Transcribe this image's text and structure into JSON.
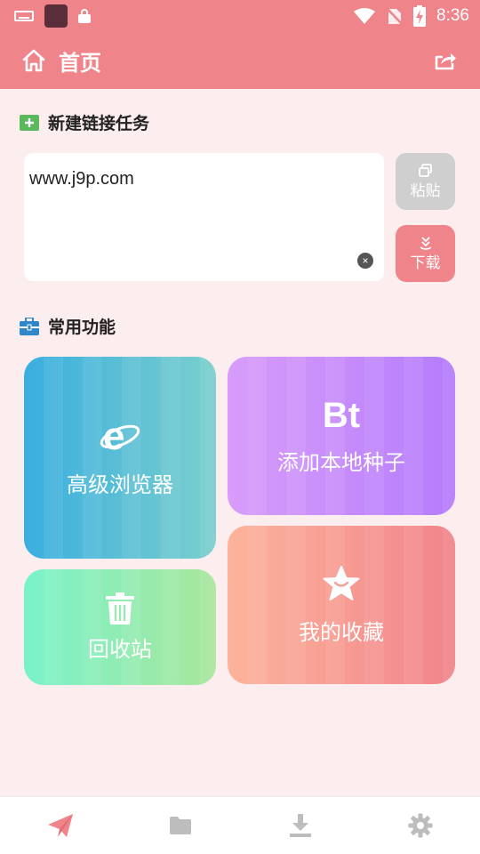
{
  "status_bar": {
    "time": "8:36"
  },
  "app_bar": {
    "title": "首页"
  },
  "new_task": {
    "heading": "新建链接任务",
    "url_value": "www.j9p.com",
    "paste_label": "粘贴",
    "download_label": "下载"
  },
  "features": {
    "heading": "常用功能",
    "browser_label": "高级浏览器",
    "bt_badge": "Bt",
    "bt_label": "添加本地种子",
    "trash_label": "回收站",
    "favorites_label": "我的收藏"
  },
  "bottom_nav": {
    "items": [
      {
        "icon": "send-icon",
        "active": true
      },
      {
        "icon": "folder-icon",
        "active": false
      },
      {
        "icon": "download-icon",
        "active": false
      },
      {
        "icon": "gear-icon",
        "active": false
      }
    ]
  },
  "colors": {
    "primary": "#f0848b",
    "background": "#fcedee",
    "nav_active": "#f0848b",
    "nav_inactive": "#bdbdbd"
  }
}
